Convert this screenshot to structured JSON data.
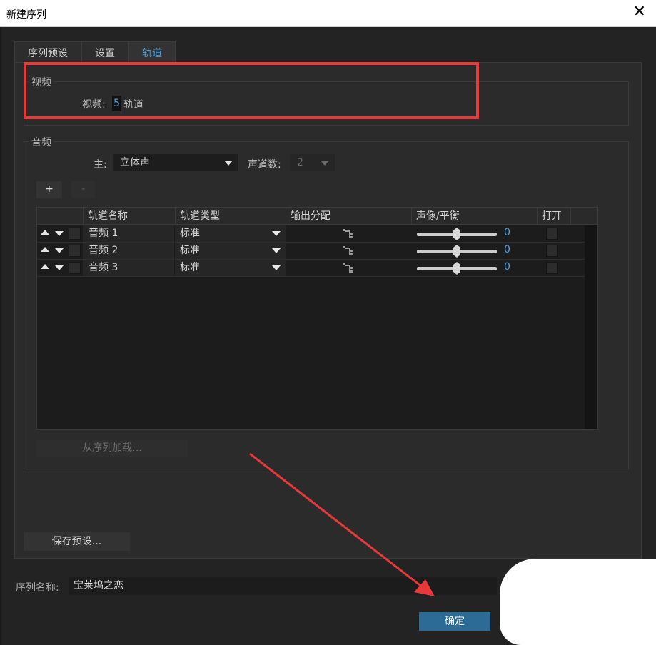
{
  "window": {
    "title": "新建序列",
    "close_glyph": "✕"
  },
  "tabs": [
    "序列预设",
    "设置",
    "轨道"
  ],
  "active_tab": "轨道",
  "video": {
    "group_label": "视频",
    "tracks_label": "视频:",
    "tracks_value": "5",
    "tracks_unit": "轨道"
  },
  "audio": {
    "group_label": "音频",
    "master_label": "主:",
    "master_value": "立体声",
    "channels_label": "声道数:",
    "channels_value": "2",
    "add_label": "+",
    "remove_label": "-",
    "columns": [
      "轨道名称",
      "轨道类型",
      "输出分配",
      "声像/平衡",
      "打开"
    ],
    "rows": [
      {
        "name": "音频 1",
        "type": "标准",
        "pan": "0"
      },
      {
        "name": "音频 2",
        "type": "标准",
        "pan": "0"
      },
      {
        "name": "音频 3",
        "type": "标准",
        "pan": "0"
      }
    ],
    "load_from_sequence": "从序列加载..."
  },
  "save_preset": "保存预设...",
  "sequence_name": {
    "label": "序列名称:",
    "value": "宝莱坞之恋"
  },
  "ok_label": "确定",
  "colors": {
    "accent": "#4fa3e6",
    "highlight": "#e8383a",
    "ok_button": "#2b6b95"
  }
}
